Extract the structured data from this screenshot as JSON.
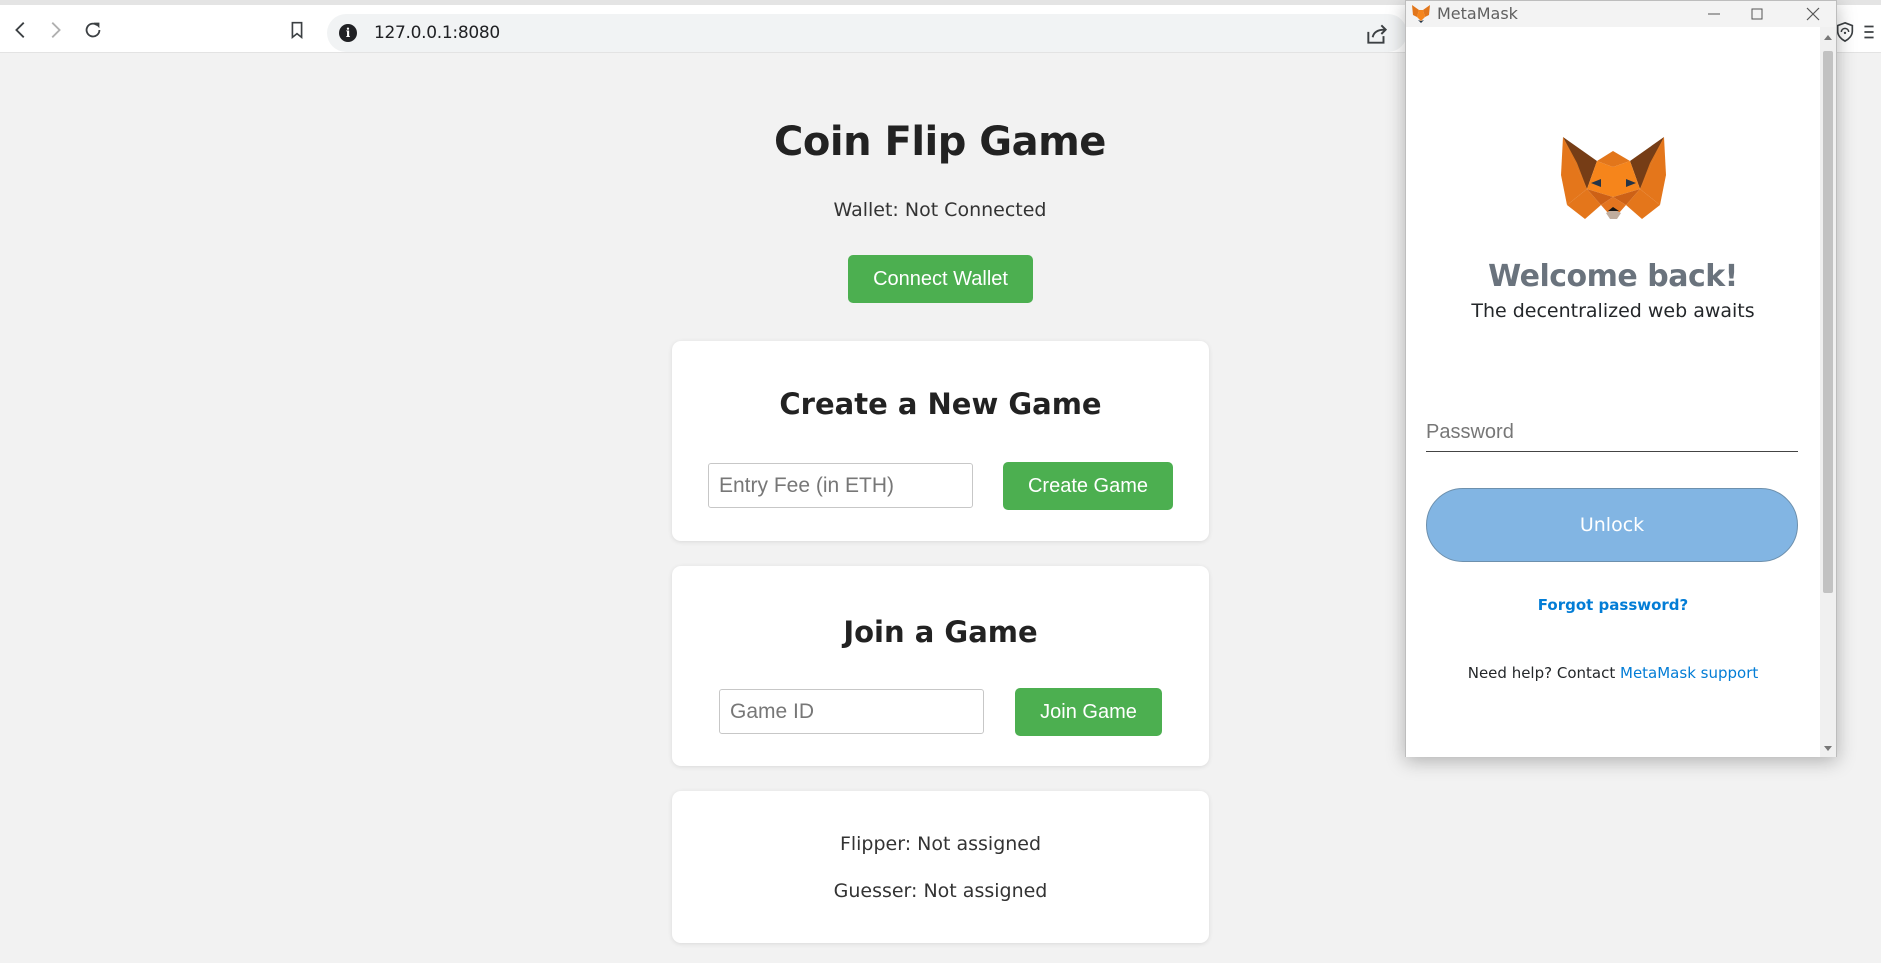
{
  "browser": {
    "url": "127.0.0.1:8080"
  },
  "page": {
    "title": "Coin Flip Game",
    "wallet_status": "Wallet: Not Connected",
    "connect_button": "Connect Wallet",
    "create_card": {
      "title": "Create a New Game",
      "entry_fee_placeholder": "Entry Fee (in ETH)",
      "entry_fee_value": "",
      "button": "Create Game"
    },
    "join_card": {
      "title": "Join a Game",
      "game_id_placeholder": "Game ID",
      "game_id_value": "",
      "button": "Join Game"
    },
    "status_card": {
      "flipper": "Flipper: Not assigned",
      "guesser": "Guesser: Not assigned"
    }
  },
  "metamask": {
    "window_title": "MetaMask",
    "welcome": "Welcome back!",
    "tagline": "The decentralized web awaits",
    "password_placeholder": "Password",
    "password_value": "",
    "unlock_button": "Unlock",
    "forgot_link": "Forgot password?",
    "help_prefix": "Need help? Contact",
    "help_link": "MetaMask support"
  },
  "colors": {
    "accent_green": "#4caf50",
    "metamask_blue": "#037dd6",
    "unlock_disabled": "#82b5e3",
    "page_background": "#f2f2f2"
  },
  "icons": [
    "back-icon",
    "forward-icon",
    "reload-icon",
    "bookmark-icon",
    "site-info-icon",
    "share-icon",
    "shield-icon",
    "menu-icon",
    "metamask-fox-icon",
    "minimize-icon",
    "maximize-icon",
    "close-icon"
  ]
}
